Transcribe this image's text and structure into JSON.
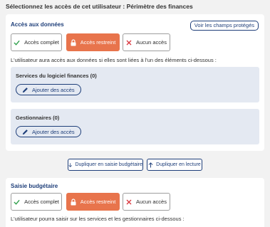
{
  "page": {
    "heading": "Sélectionnez les accès de cet utilisateur : Périmètre des finances"
  },
  "data_access": {
    "title": "Accès aux données",
    "show_fields_button": "Voir les champs protégés",
    "options": {
      "full": "Accès complet",
      "restricted": "Accès restreint",
      "none": "Aucun accès"
    },
    "selected": "restricted",
    "description": "L'utilisateur aura accès aux données si elles sont liées à l'un des éléments ci-dessous :",
    "panels": [
      {
        "title": "Services du logiciel finances (0)",
        "add_label": "Ajouter des accès"
      },
      {
        "title": "Gestionnaires (0)",
        "add_label": "Ajouter des accès"
      }
    ]
  },
  "duplicate": {
    "budget_label": "Dupliquer en saisie budgétaire",
    "read_label": "Dupliquer en lecture"
  },
  "budget_entry": {
    "title": "Saisie budgétaire",
    "options": {
      "full": "Accès complet",
      "restricted": "Accès restreint",
      "none": "Aucun accès"
    },
    "selected": "restricted",
    "description": "L'utilisateur pourra saisir sur les services et les gestionnaires ci-dessous :"
  },
  "colors": {
    "accent": "#e8744c",
    "primary": "#1f3f7a",
    "panel_bg": "#e4e9f2",
    "check": "#2e9e4a",
    "cross": "#d9363e"
  },
  "icons": [
    "check-icon",
    "lock-icon",
    "close-icon",
    "pencil-icon",
    "arrow-down-icon",
    "arrow-up-icon"
  ]
}
